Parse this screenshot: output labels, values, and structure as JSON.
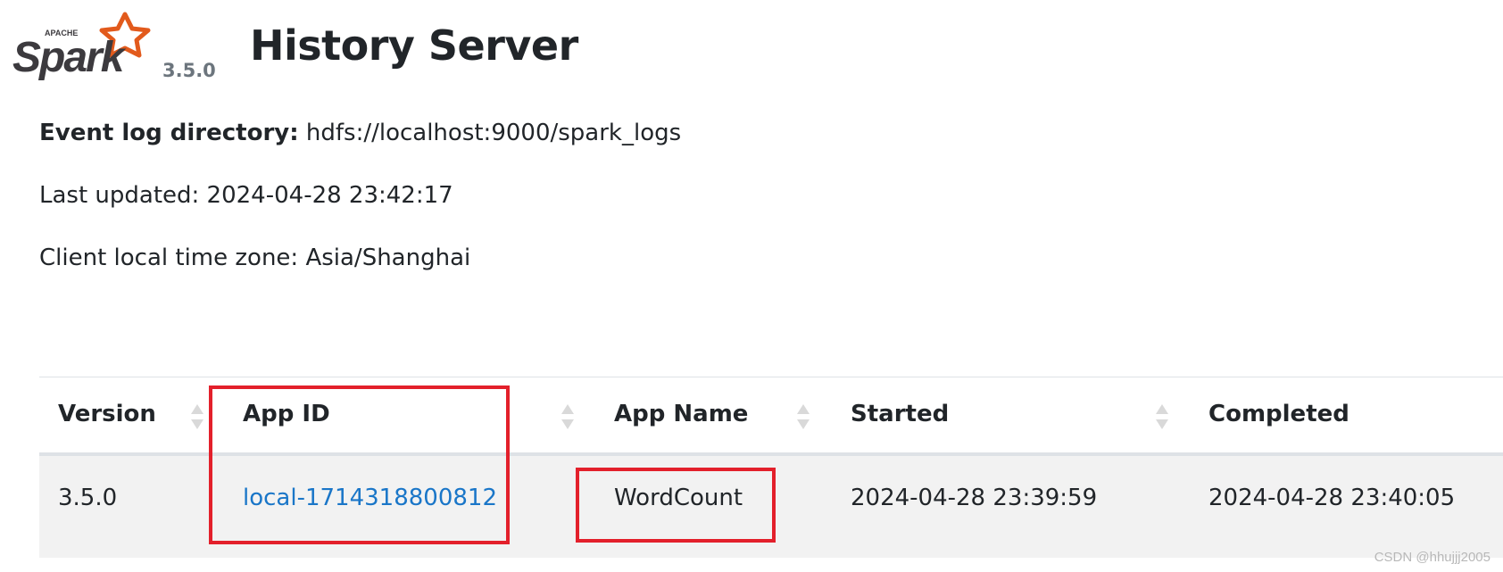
{
  "header": {
    "logo_top_text": "APACHE",
    "logo_text": "Spark",
    "version": "3.5.0",
    "title": "History Server"
  },
  "info": {
    "event_log_label": "Event log directory:",
    "event_log_value": "hdfs://localhost:9000/spark_logs",
    "last_updated": "Last updated: 2024-04-28 23:42:17",
    "timezone": "Client local time zone: Asia/Shanghai"
  },
  "table": {
    "columns": [
      "Version",
      "App ID",
      "App Name",
      "Started",
      "Completed"
    ],
    "rows": [
      {
        "version": "3.5.0",
        "app_id": "local-1714318800812",
        "app_name": "WordCount",
        "started": "2024-04-28 23:39:59",
        "completed": "2024-04-28 23:40:05"
      }
    ]
  },
  "colors": {
    "link": "#1a76c8",
    "highlight": "#e3202b",
    "row_bg": "#f2f2f2",
    "spark_orange": "#e25a1c"
  },
  "watermark": "CSDN @hhujjj2005"
}
